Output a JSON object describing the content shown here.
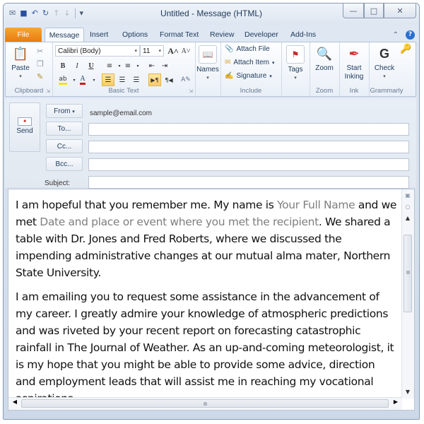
{
  "window": {
    "title": "Untitled - Message (HTML)",
    "controls": {
      "minimize": "—",
      "maximize": "□",
      "close": "✕"
    }
  },
  "quick_access": [
    {
      "name": "outlook-app-icon",
      "glyph": "✉"
    },
    {
      "name": "save-icon",
      "glyph": "■"
    },
    {
      "name": "undo-icon",
      "glyph": "↶"
    },
    {
      "name": "redo-icon",
      "glyph": "↻"
    },
    {
      "name": "previous-icon",
      "glyph": "↑"
    },
    {
      "name": "next-icon",
      "glyph": "↓"
    },
    {
      "name": "customize-qat-icon",
      "glyph": "▾"
    }
  ],
  "tabs": [
    "File",
    "Message",
    "Insert",
    "Options",
    "Format Text",
    "Review",
    "Developer",
    "Add-Ins"
  ],
  "active_tab": "Message",
  "ribbon": {
    "clipboard": {
      "label": "Clipboard",
      "paste": "Paste"
    },
    "basic_text": {
      "label": "Basic Text",
      "font_name": "Calibri (Body)",
      "font_size": "11",
      "grow": "A˄",
      "shrink": "A˅",
      "bold": "B",
      "italic": "I",
      "underline": "U",
      "highlight_color": "#f4e21a",
      "font_color": "#d01b1b"
    },
    "names": {
      "label": "Names"
    },
    "include": {
      "label": "Include",
      "attach_file": "Attach File",
      "attach_item": "Attach Item",
      "signature": "Signature"
    },
    "tags": {
      "label": "Tags"
    },
    "zoom": {
      "label": "Zoom",
      "button": "Zoom"
    },
    "ink": {
      "label": "Ink",
      "button_line1": "Start",
      "button_line2": "Inking"
    },
    "grammarly": {
      "label": "Grammarly",
      "button": "Check"
    }
  },
  "header": {
    "send": "Send",
    "from_button": "From",
    "from_value": "sample@email.com",
    "to_button": "To...",
    "cc_button": "Cc...",
    "bcc_button": "Bcc...",
    "subject_label": "Subject:",
    "to_value": "",
    "cc_value": "",
    "bcc_value": "",
    "subject_value": ""
  },
  "body": {
    "p1": {
      "t1": "I am hopeful that you remember me. My name is ",
      "ph1": "Your Full Name",
      "t2": " and we met ",
      "ph2": "Date and place or event where you met the recipient",
      "t3": ". We shared a table with Dr. Jones and Fred Roberts, where we discussed the impending administrative changes at our mutual alma mater, Northern State University."
    },
    "p2": "I am emailing you to request some assistance in the advancement of my career. I greatly admire your knowledge of atmospheric predictions and was riveted by your recent report on forecasting catastrophic rainfall in The Journal of Weather. As an up-and-coming meteorologist, it is my hope that you might be able to provide some advice, direction and employment leads that will assist me in reaching my vocational aspirations."
  },
  "colors": {
    "file_tab": "#e77d0f",
    "placeholder_text": "#7f7f7f",
    "title_text": "#1e395b"
  }
}
